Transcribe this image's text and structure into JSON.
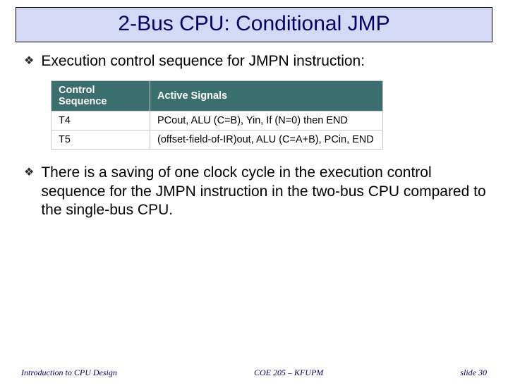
{
  "title": "2-Bus CPU: Conditional JMP",
  "bullets": {
    "b1": "Execution control sequence for JMPN instruction:",
    "b2": "There is a saving of one clock cycle in the execution control sequence for the JMPN instruction in the two-bus CPU compared to the single-bus CPU."
  },
  "chart_data": {
    "type": "table",
    "headers": [
      "Control Sequence",
      "Active Signals"
    ],
    "rows": [
      [
        "T4",
        "PCout, ALU (C=B), Yin, If (N=0) then END"
      ],
      [
        "T5",
        "(offset-field-of-IR)out, ALU (C=A+B), PCin, END"
      ]
    ]
  },
  "footer": {
    "left": "Introduction to CPU Design",
    "center": "COE 205 – KFUPM",
    "right": "slide 30"
  }
}
